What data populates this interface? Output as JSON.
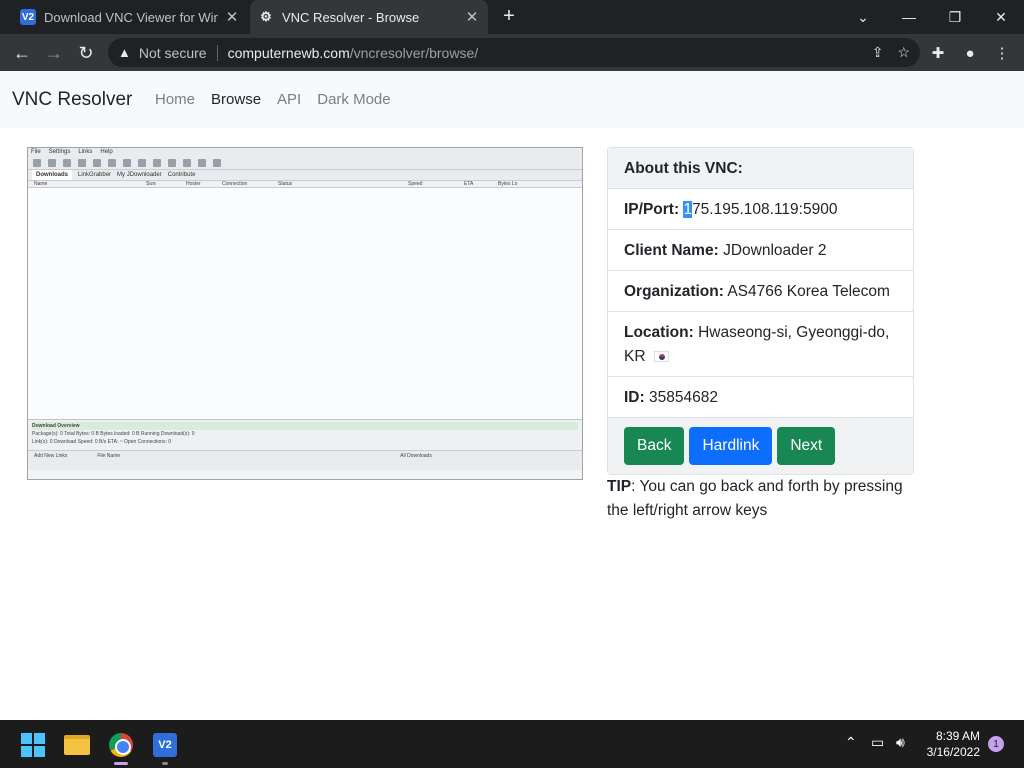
{
  "browser": {
    "tabs": [
      {
        "label": "Download VNC Viewer for Windo",
        "icon": "vnc-icon"
      },
      {
        "label": "VNC Resolver - Browse",
        "icon": "vnc-resolver-icon"
      }
    ],
    "address": {
      "security": "Not secure",
      "host": "computernewb.com",
      "path": "/vncresolver/browse/"
    }
  },
  "site": {
    "brand": "VNC Resolver",
    "nav": [
      {
        "label": "Home"
      },
      {
        "label": "Browse"
      },
      {
        "label": "API"
      },
      {
        "label": "Dark Mode"
      }
    ]
  },
  "preview": {
    "menu": [
      "File",
      "Settings",
      "Links",
      "Help"
    ],
    "tabs": [
      "Downloads",
      "LinkGrabber",
      "My JDownloader",
      "Contribute"
    ],
    "columns": [
      "Name",
      "Size",
      "Hoster",
      "Connection",
      "Status",
      "Speed",
      "ETA",
      "Bytes Lo"
    ],
    "overview_title": "Download Overview",
    "overview_rows": [
      "Package(s): 0   Total Bytes: 0 B   Bytes loaded: 0 B   Running Download(s): 0",
      "Link(s): 0   Download Speed: 0 B/s   ETA: ~   Open Connections: 0"
    ],
    "bottom": [
      "Add New Links",
      "File Name",
      "All Downloads"
    ]
  },
  "about": {
    "header": "About this VNC:",
    "ip_label": "IP/Port:",
    "ip_selected": "1",
    "ip_rest": "75.195.108.119:5900",
    "client_label": "Client Name:",
    "client_value": "JDownloader 2",
    "org_label": "Organization:",
    "org_value": "AS4766 Korea Telecom",
    "location_label": "Location:",
    "location_value": "Hwaseong-si, Gyeonggi-do, KR",
    "id_label": "ID:",
    "id_value": "35854682",
    "buttons": {
      "back": "Back",
      "hardlink": "Hardlink",
      "next": "Next"
    },
    "colors": {
      "green": "#198754",
      "blue": "#0d6efd"
    }
  },
  "tip": {
    "label": "TIP",
    "text": ": You can go back and forth by pressing the left/right arrow keys"
  },
  "taskbar": {
    "time": "8:39 AM",
    "date": "3/16/2022",
    "notifications": "1"
  }
}
